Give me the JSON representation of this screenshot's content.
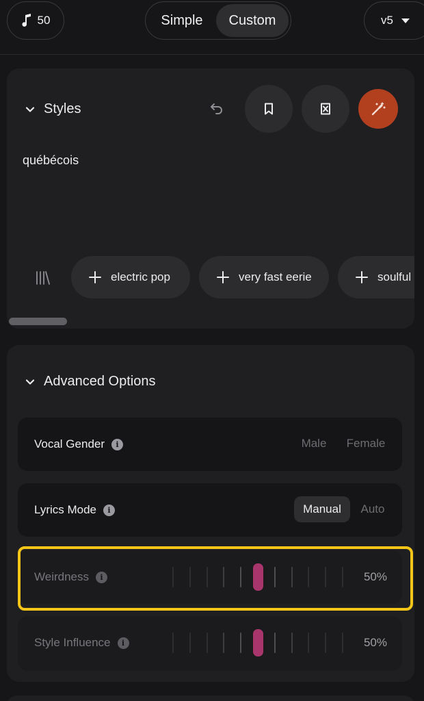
{
  "topbar": {
    "credits": "50",
    "modes": [
      "Simple",
      "Custom"
    ],
    "active_mode": "Custom",
    "version": "v5"
  },
  "styles": {
    "title": "Styles",
    "text": "québécois",
    "chips": [
      "electric pop",
      "very fast eerie",
      "soulful"
    ],
    "accent_color": "#b2401f"
  },
  "advanced": {
    "title": "Advanced Options",
    "vocal_gender": {
      "label": "Vocal Gender",
      "options": [
        "Male",
        "Female"
      ]
    },
    "lyrics_mode": {
      "label": "Lyrics Mode",
      "options": [
        "Manual",
        "Auto"
      ],
      "selected": "Manual"
    },
    "weirdness": {
      "label": "Weirdness",
      "value": 50,
      "display": "50%"
    },
    "style_influence": {
      "label": "Style Influence",
      "value": 50,
      "display": "50%"
    },
    "slider_color": "#a8356b"
  },
  "highlight_color": "#f5c518"
}
